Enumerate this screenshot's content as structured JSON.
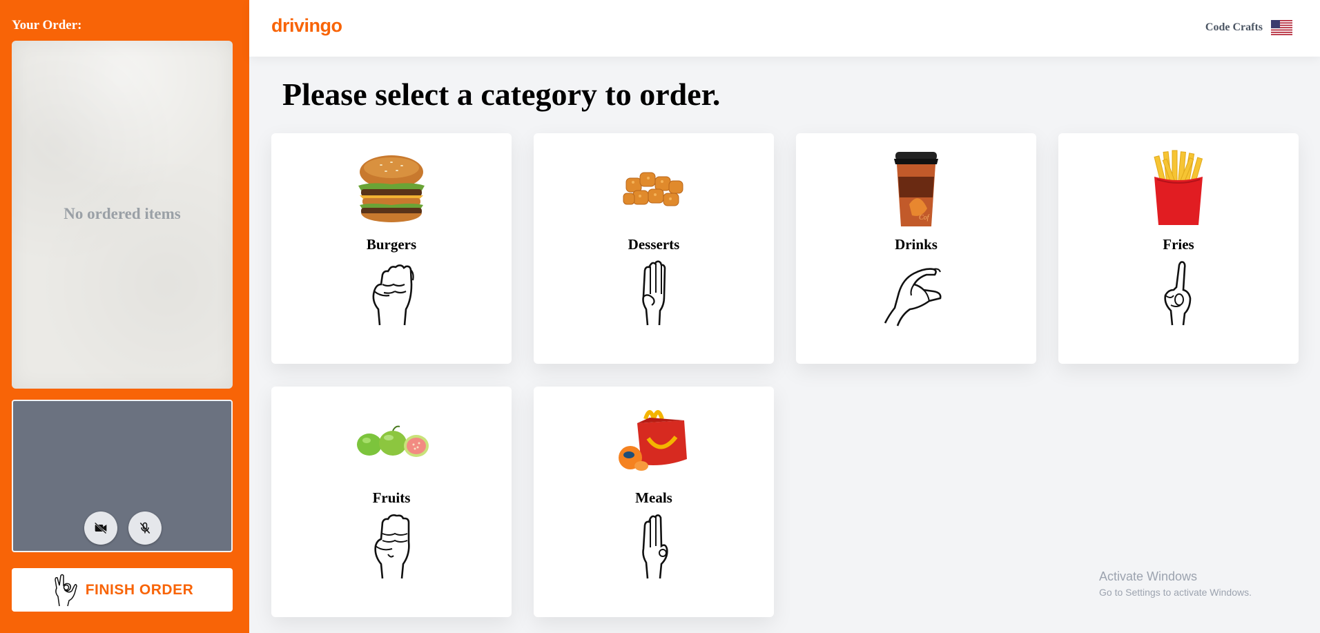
{
  "sidebar": {
    "order_title": "Your Order:",
    "empty_text": "No ordered items",
    "finish_label": "FINISH ORDER"
  },
  "header": {
    "logo": "drivingo",
    "brand": "Code Crafts",
    "flag_icon": "us-flag-icon"
  },
  "main": {
    "title": "Please select a category to order.",
    "categories": [
      {
        "label": "Burgers",
        "icon": "burger-icon",
        "sign": "hand-sign-a-icon"
      },
      {
        "label": "Desserts",
        "icon": "dessert-icon",
        "sign": "hand-sign-b-icon"
      },
      {
        "label": "Drinks",
        "icon": "drink-cup-icon",
        "sign": "hand-sign-c-icon"
      },
      {
        "label": "Fries",
        "icon": "fries-icon",
        "sign": "hand-sign-d-icon"
      },
      {
        "label": "Fruits",
        "icon": "fruits-icon",
        "sign": "hand-sign-e-icon"
      },
      {
        "label": "Meals",
        "icon": "meal-box-icon",
        "sign": "hand-sign-f-icon"
      }
    ]
  },
  "watermark": {
    "title": "Activate Windows",
    "subtitle": "Go to Settings to activate Windows."
  },
  "colors": {
    "accent": "#f86407",
    "video_bg": "#6b7280"
  }
}
